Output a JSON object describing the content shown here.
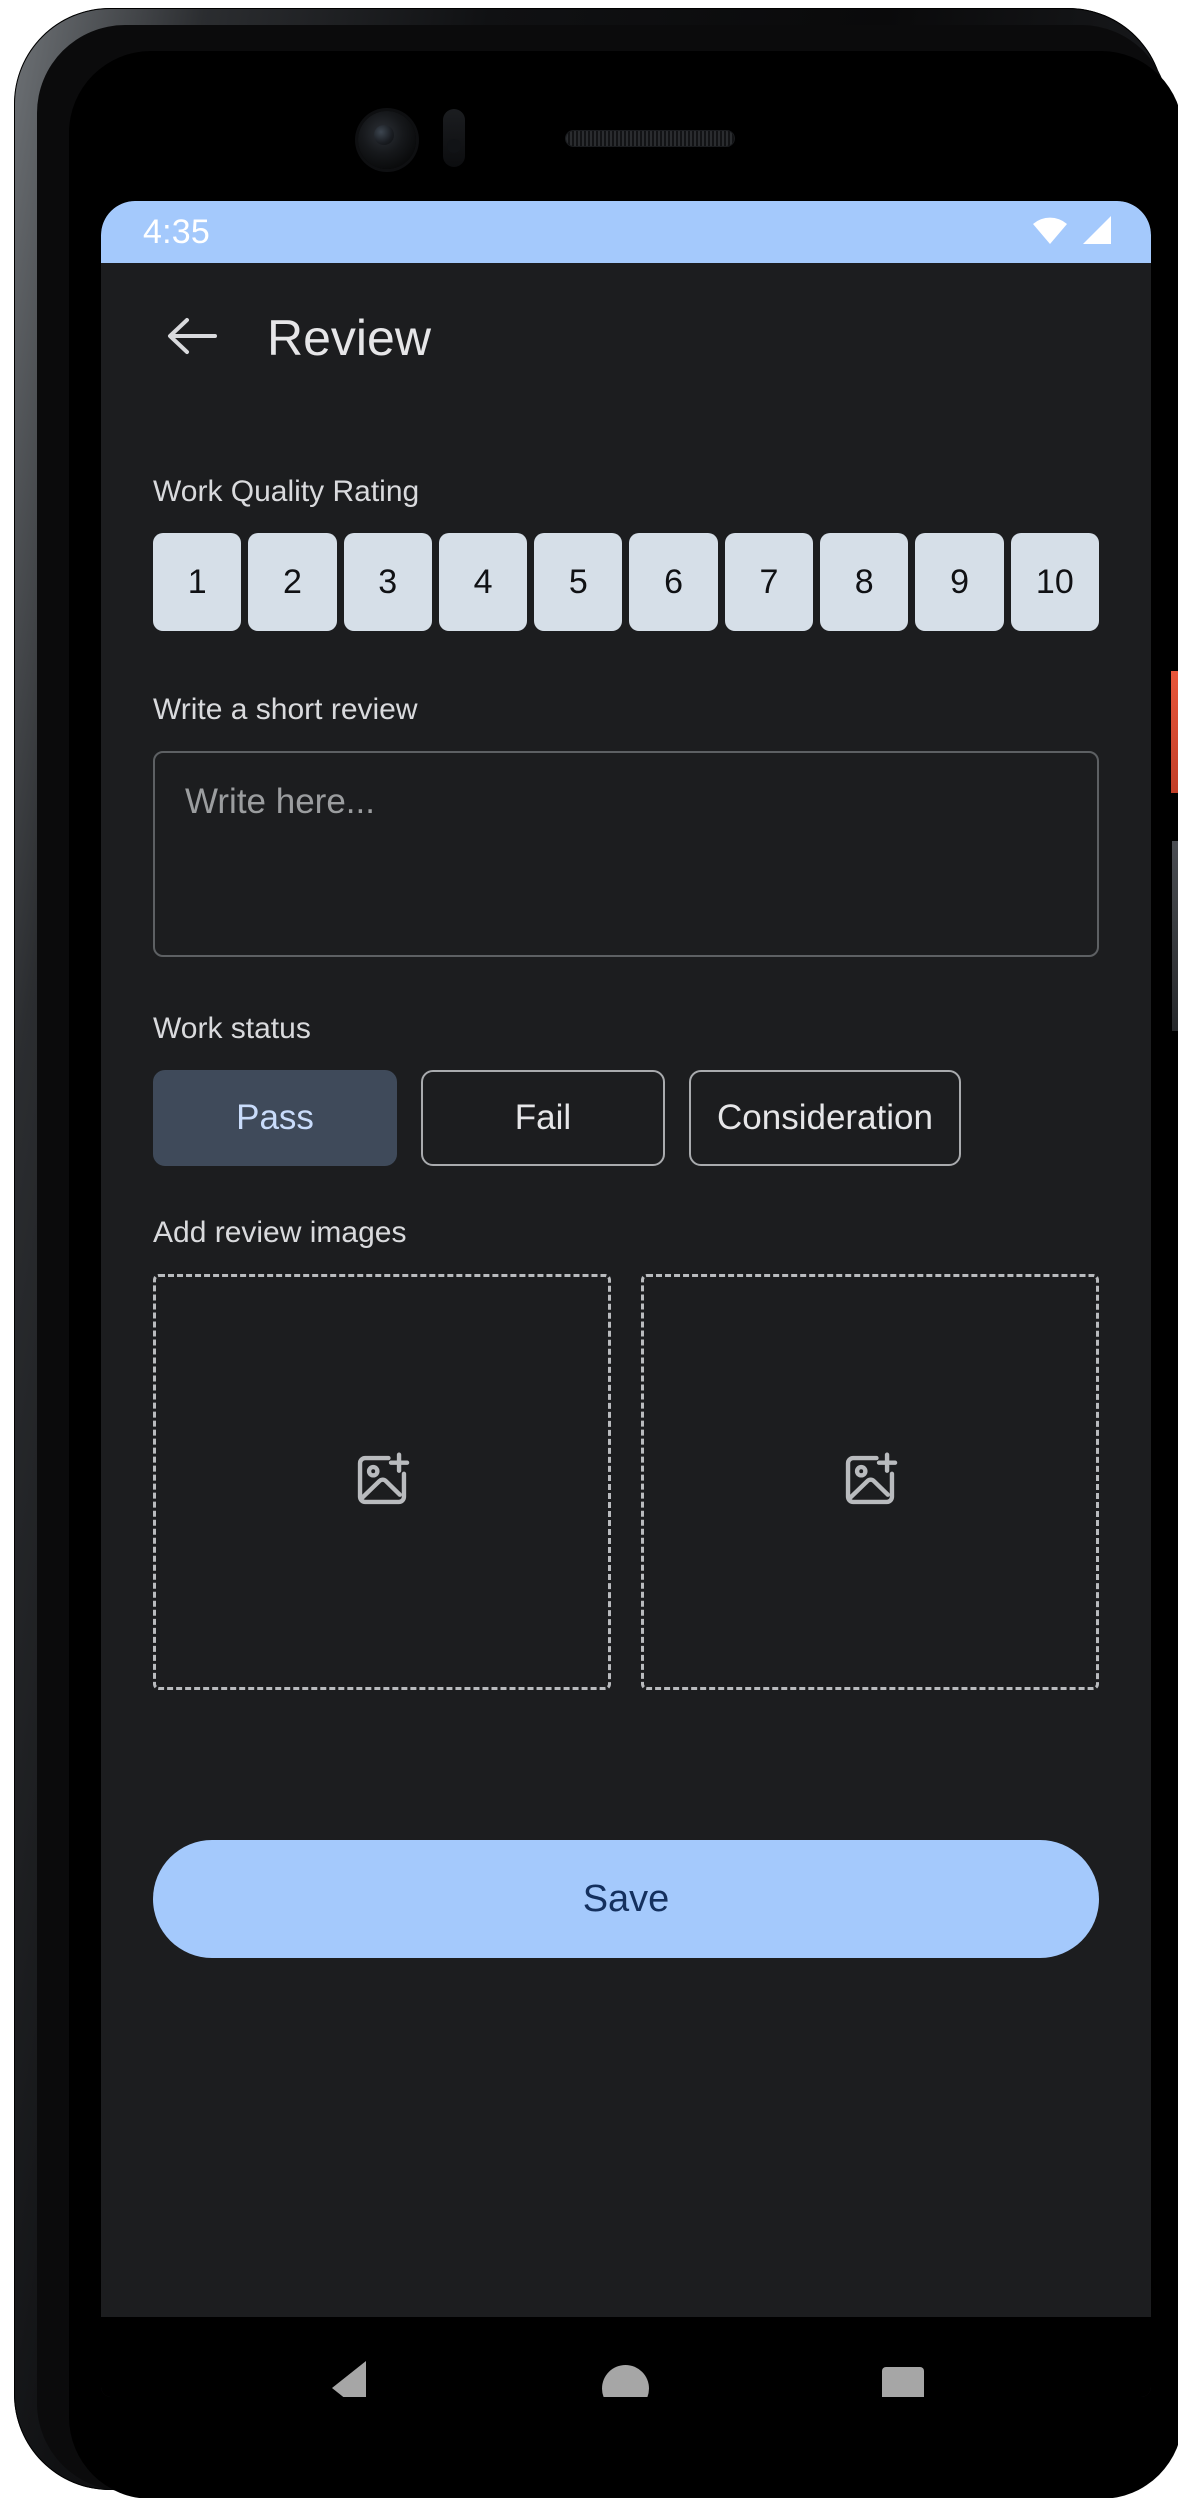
{
  "status_bar": {
    "time": "4:35",
    "icons": [
      "wifi-icon",
      "signal-icon"
    ],
    "background_color": "#a4c9fc",
    "text_color": "#ffffff"
  },
  "appbar": {
    "back_icon": "arrow-left-icon",
    "title": "Review"
  },
  "rating_section": {
    "label": "Work Quality Rating",
    "options": [
      "1",
      "2",
      "3",
      "4",
      "5",
      "6",
      "7",
      "8",
      "9",
      "10"
    ],
    "selected": null,
    "chip_color": "#d6dfe8",
    "chip_text_color": "#101114"
  },
  "review_section": {
    "label": "Write a short review",
    "value": "",
    "placeholder": "Write here..."
  },
  "work_status_section": {
    "label": "Work status",
    "options": [
      {
        "label": "Pass",
        "selected": true
      },
      {
        "label": "Fail",
        "selected": false
      },
      {
        "label": "Consideration",
        "selected": false
      }
    ],
    "selected_background": "#3f4a5a",
    "selected_text_color": "#c9dcfb"
  },
  "images_section": {
    "label": "Add review images",
    "slots": [
      {
        "icon": "add-image-icon",
        "filled": false
      },
      {
        "icon": "add-image-icon",
        "filled": false
      }
    ]
  },
  "save_button": {
    "label": "Save",
    "background_color": "#a4c9fc",
    "text_color": "#14305e"
  },
  "nav_bar": {
    "back": "nav-back-icon",
    "home": "nav-home-icon",
    "recents": "nav-recents-icon"
  }
}
